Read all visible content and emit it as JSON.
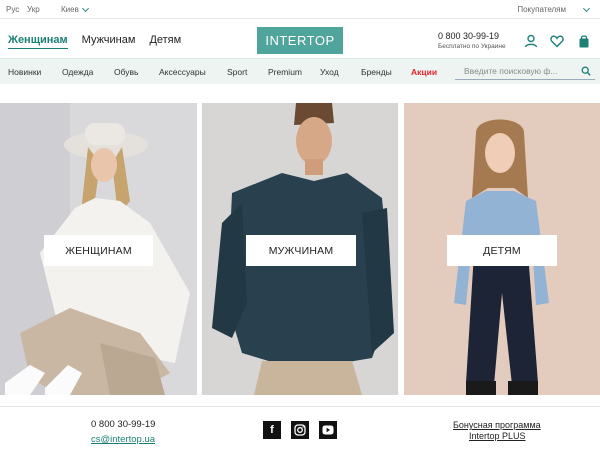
{
  "topbar": {
    "lang_ru": "Рус",
    "lang_ua": "Укр",
    "city": "Киев",
    "buyers": "Покупателям"
  },
  "header": {
    "tabs": [
      {
        "label": "Женщинам",
        "active": true
      },
      {
        "label": "Мужчинам",
        "active": false
      },
      {
        "label": "Детям",
        "active": false
      }
    ],
    "logo": "INTERTOP",
    "phone": "0 800 30-99-19",
    "phone_note": "Бесплатно по Украине",
    "icons": [
      "user-icon",
      "heart-icon",
      "bag-icon"
    ],
    "accent": "#1c8077"
  },
  "nav": {
    "items": [
      "Новинки",
      "Одежда",
      "Обувь",
      "Аксессуары",
      "Sport",
      "Premium",
      "Уход",
      "Бренды",
      "Акции"
    ],
    "sale_color": "#e0262f",
    "search_placeholder": "Введите поисковую ф..."
  },
  "hero": {
    "tiles": [
      {
        "label": "ЖЕНЩИНАМ"
      },
      {
        "label": "МУЖЧИНАМ"
      },
      {
        "label": "ДЕТЯМ"
      }
    ]
  },
  "footer": {
    "phone": "0 800 30-99-19",
    "email": "cs@intertop.ua",
    "social": [
      "facebook-icon",
      "instagram-icon",
      "youtube-icon"
    ],
    "bonus_line1": "Бонусная программа",
    "bonus_line2": "Intertop PLUS"
  }
}
